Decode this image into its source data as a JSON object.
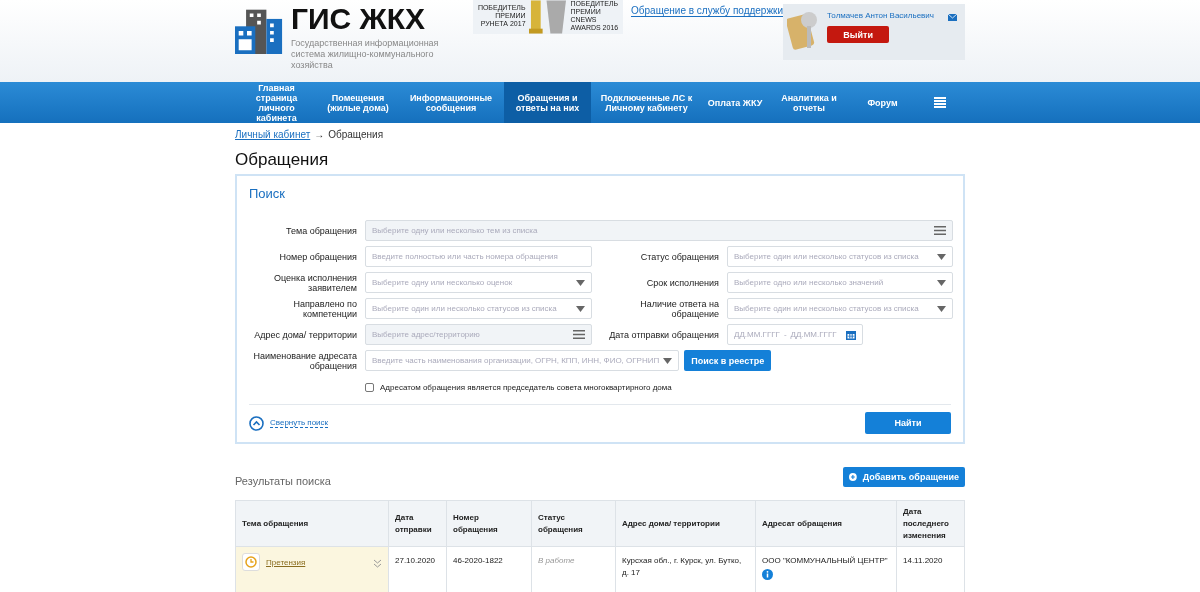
{
  "header": {
    "logo_title": "ГИС ЖКХ",
    "logo_subtitle": "Государственная информационная система жилищно-коммунального хозяйства",
    "awards": [
      {
        "text": "ПОБЕДИТЕЛЬ ПРЕМИИ РУНЕТА 2017"
      },
      {
        "text": "ПОБЕДИТЕЛЬ ПРЕМИИ CNEWS AWARDS 2016"
      }
    ],
    "support_link": "Обращение в службу поддержки",
    "user_name": "Толмачев Антон Васильевич",
    "logout": "Выйти"
  },
  "nav": [
    {
      "label": "Главная страница личного кабинета",
      "selected": false
    },
    {
      "label": "Помещения (жилые дома)",
      "selected": false
    },
    {
      "label": "Информационные сообщения",
      "selected": false
    },
    {
      "label": "Обращения и ответы на них",
      "selected": true
    },
    {
      "label": "Подключенные ЛС к Личному кабинету",
      "selected": false
    },
    {
      "label": "Оплата ЖКУ",
      "selected": false
    },
    {
      "label": "Аналитика и отчеты",
      "selected": false
    },
    {
      "label": "Форум",
      "selected": false
    }
  ],
  "breadcrumb": {
    "link": "Личный кабинет",
    "arrow": "→",
    "current": "Обращения"
  },
  "page_title": "Обращения",
  "search": {
    "title": "Поиск",
    "rows": [
      [
        {
          "label": "Тема обращения",
          "kind": "list",
          "placeholder": "Выберите одну или несколько тем из списка"
        }
      ],
      [
        {
          "label": "Номер обращения",
          "kind": "text",
          "placeholder": "Введите полностью или часть номера обращения"
        },
        {
          "label": "Статус обращения",
          "kind": "select",
          "placeholder": "Выберите один или несколько статусов из списка"
        }
      ],
      [
        {
          "label": "Оценка исполнения заявителем",
          "kind": "select",
          "placeholder": "Выберите одну или несколько оценок"
        },
        {
          "label": "Срок исполнения",
          "kind": "select",
          "placeholder": "Выберите одно или несколько значений"
        }
      ],
      [
        {
          "label": "Направлено по компетенции",
          "kind": "select",
          "placeholder": "Выберите один или несколько статусов из списка"
        },
        {
          "label": "Наличие ответа на обращение",
          "kind": "select",
          "placeholder": "Выберите один или несколько статусов из списка"
        }
      ],
      [
        {
          "label": "Адрес дома/ территории",
          "kind": "list",
          "placeholder": "Выберите адрес/территорию"
        },
        {
          "label": "Дата отправки обращения",
          "kind": "date",
          "placeholder": "ДД.ММ.ГГГГ",
          "separator": "-",
          "placeholder_to": "ДД.ММ.ГГГГ"
        }
      ],
      [
        {
          "label": "Наименование адресата обращения",
          "kind": "select",
          "placeholder": "Введите часть наименования организации, ОГРН, КПП, ИНН, ФИО, ОГРНИП",
          "button": "Поиск в реестре"
        }
      ]
    ],
    "checkbox": {
      "label": "Адресатом обращения является председатель совета многоквартирного дома",
      "checked": false
    },
    "collapse": "Свернуть поиск",
    "submit": "Найти"
  },
  "results": {
    "title": "Результаты поиска",
    "add_button": "Добавить обращение",
    "columns": [
      "Тема обращения",
      "Дата отправки",
      "Номер обращения",
      "Статус обращения",
      "Адрес дома/ территории",
      "Адресат обращения",
      "Дата последнего изменения"
    ],
    "rows": [
      {
        "topic": "Претензия",
        "sent": "27.10.2020",
        "number": "46-2020-1822",
        "status": "В работе",
        "address": "Курсхая обл., г. Курск, ул. Бутко, д. 17",
        "addressee": "ООО \"КОММУНАЛЬНЫЙ ЦЕНТР\"",
        "changed": "14.11.2020"
      }
    ]
  }
}
